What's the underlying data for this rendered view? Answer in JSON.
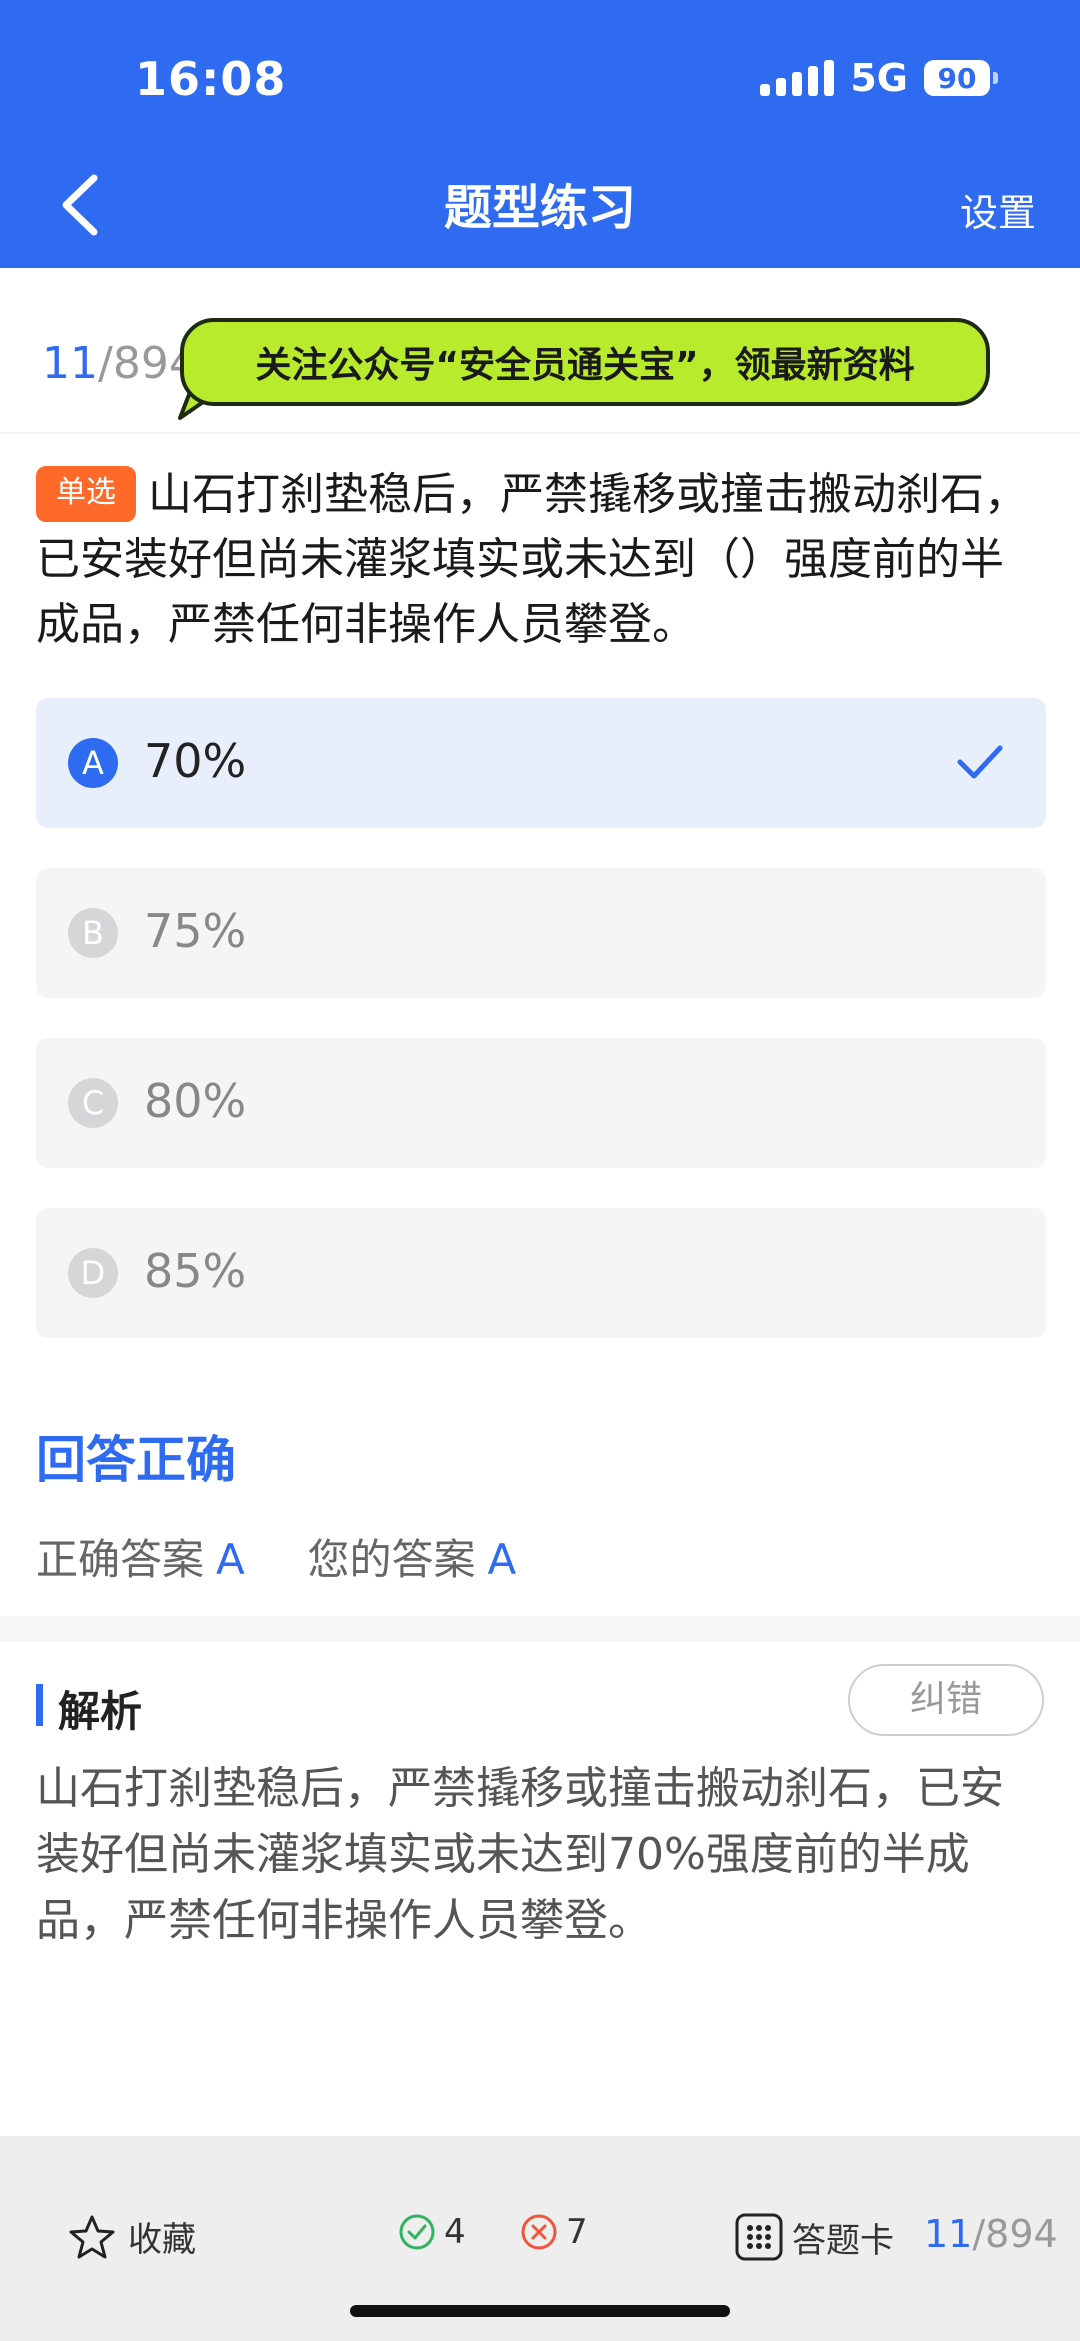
{
  "status_bar": {
    "time": "16:08",
    "network": "5G",
    "battery": "90"
  },
  "nav": {
    "title": "题型练习",
    "settings_label": "设置"
  },
  "progress": {
    "current": "11",
    "total": "/894"
  },
  "banner": {
    "text": "关注公众号“安全员通关宝”，领最新资料"
  },
  "question": {
    "type_tag": "单选",
    "text": "山石打刹垫稳后，严禁撬移或撞击搬动刹石，已安装好但尚未灌浆填实或未达到（）强度前的半成品，严禁任何非操作人员攀登。"
  },
  "options": [
    {
      "letter": "A",
      "text": "70%",
      "selected": true
    },
    {
      "letter": "B",
      "text": "75%",
      "selected": false
    },
    {
      "letter": "C",
      "text": "80%",
      "selected": false
    },
    {
      "letter": "D",
      "text": "85%",
      "selected": false
    }
  ],
  "result": {
    "status": "回答正确",
    "correct_label": "正确答案",
    "correct_value": "A",
    "your_label": "您的答案",
    "your_value": "A"
  },
  "analysis": {
    "title": "解析",
    "report_label": "纠错",
    "text": "山石打刹垫稳后，严禁撬移或撞击搬动刹石，已安装好但尚未灌浆填实或未达到70%强度前的半成品，严禁任何非操作人员攀登。"
  },
  "bottom_bar": {
    "favorite_label": "收藏",
    "correct_count": "4",
    "wrong_count": "7",
    "answer_card_label": "答题卡",
    "progress_current": "11",
    "progress_total": "/894"
  },
  "colors": {
    "primary": "#2f6bf0",
    "tag": "#ff6a2a",
    "banner": "#b8eb2c",
    "correct": "#2fb360",
    "wrong": "#f0553a"
  },
  "icons": [
    "back-chevron-icon",
    "signal-icon",
    "battery-icon",
    "check-icon",
    "star-icon",
    "correct-circle-icon",
    "wrong-circle-icon",
    "grid-icon"
  ]
}
